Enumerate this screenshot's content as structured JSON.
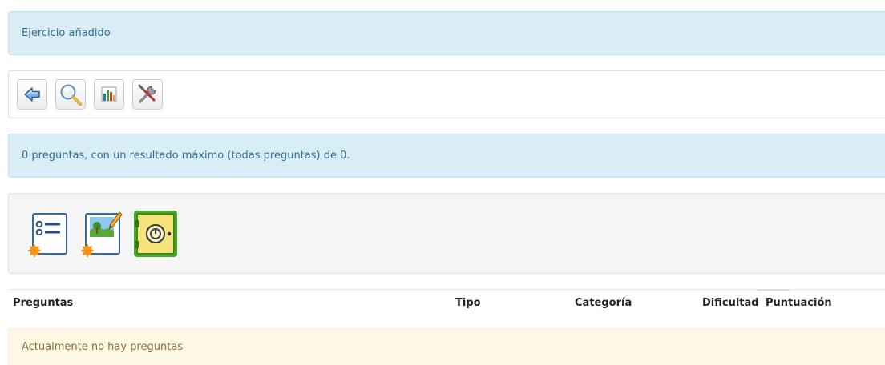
{
  "notice": {
    "message": "Ejercicio añadido"
  },
  "toolbar": {
    "buttons": [
      {
        "icon": "back-arrow-icon"
      },
      {
        "icon": "magnifier-preview-icon"
      },
      {
        "icon": "bar-chart-results-icon"
      },
      {
        "icon": "tools-settings-icon"
      }
    ]
  },
  "summary": {
    "message": "0 preguntas, con un resultado máximo (todas preguntas) de 0."
  },
  "question_actions": [
    {
      "icon": "new-multiple-choice-question-icon"
    },
    {
      "icon": "new-image-question-icon"
    },
    {
      "icon": "question-bank-safe-icon"
    }
  ],
  "table": {
    "headers": [
      "Preguntas",
      "Tipo",
      "Categoría",
      "Dificultad",
      "Puntuación"
    ],
    "empty_message": "Actualmente no hay preguntas"
  },
  "colors": {
    "info_bg": "#d9edf7",
    "info_text": "#31708f",
    "warning_bg": "#fcf8e3",
    "warning_text": "#8a6d3b",
    "panel_bg": "#f5f5f5"
  }
}
